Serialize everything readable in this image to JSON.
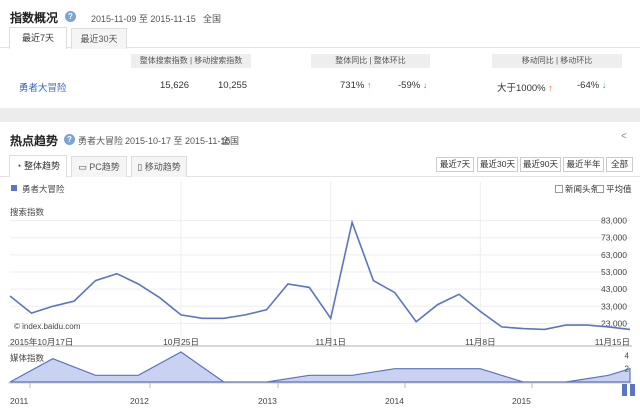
{
  "overview": {
    "title": "指数概况",
    "date_range": "2015-11-09 至 2015-11-15",
    "region": "全国",
    "tabs": [
      {
        "label": "最近7天",
        "active": true
      },
      {
        "label": "最近30天",
        "active": false
      }
    ],
    "headers": {
      "index_pc_mobile": "整体搜索指数 | 移动搜索指数",
      "overall_compare": "整体同比 | 整体环比",
      "mobile_compare": "移动同比 | 移动环比"
    },
    "row": {
      "keyword": "勇者大冒险",
      "overall_index": "15,626",
      "mobile_index": "10,255",
      "overall_yoy": "731%",
      "overall_yoy_dir": "up",
      "overall_mom": "-59%",
      "overall_mom_dir": "down",
      "mobile_yoy": "大于1000%",
      "mobile_yoy_dir": "up",
      "mobile_mom": "-64%",
      "mobile_mom_dir": "down"
    }
  },
  "trend": {
    "title": "热点趋势",
    "keyword": "勇者大冒险",
    "date_range": "2015-10-17 至 2015-11-15",
    "region": "全国",
    "tabs": [
      {
        "label": "整体趋势",
        "icon": "pie-icon",
        "active": true
      },
      {
        "label": "PC趋势",
        "icon": "monitor-icon",
        "active": false
      },
      {
        "label": "移动趋势",
        "icon": "phone-icon",
        "active": false
      }
    ],
    "range_buttons": [
      "最近7天",
      "最近30天",
      "最近90天",
      "最近半年",
      "全部"
    ],
    "legend_label": "勇者大冒险",
    "checkboxes": [
      "新闻头条",
      "平均值"
    ],
    "y_axis_label": "搜索指数",
    "media_axis_label": "媒体指数",
    "watermark": "© index.baidu.com",
    "colors": {
      "series": "#5b74c4",
      "area": "#c9d2f0",
      "accent": "#3a67c4"
    }
  },
  "chart_data": [
    {
      "type": "line",
      "title": "",
      "ylabel": "搜索指数",
      "x_tick_labels": [
        "2015年10月17日",
        "10月25日",
        "11月1日",
        "11月8日",
        "11月15日"
      ],
      "y_tick_labels": [
        "83,000",
        "73,000",
        "63,000",
        "53,000",
        "43,000",
        "33,000",
        "23,000"
      ],
      "ylim": [
        18000,
        88000
      ],
      "grid": true,
      "series": [
        {
          "name": "勇者大冒险",
          "x": [
            "2015-10-17",
            "2015-10-18",
            "2015-10-19",
            "2015-10-20",
            "2015-10-21",
            "2015-10-22",
            "2015-10-23",
            "2015-10-24",
            "2015-10-25",
            "2015-10-26",
            "2015-10-27",
            "2015-10-28",
            "2015-10-29",
            "2015-10-30",
            "2015-10-31",
            "2015-11-01",
            "2015-11-02",
            "2015-11-03",
            "2015-11-04",
            "2015-11-05",
            "2015-11-06",
            "2015-11-07",
            "2015-11-08",
            "2015-11-09",
            "2015-11-10",
            "2015-11-11",
            "2015-11-12",
            "2015-11-13",
            "2015-11-14",
            "2015-11-15"
          ],
          "values": [
            39000,
            29000,
            33000,
            36000,
            48000,
            52000,
            46000,
            38000,
            28000,
            26000,
            26000,
            28000,
            31000,
            46000,
            44000,
            26000,
            82000,
            48000,
            41000,
            24000,
            34000,
            40000,
            30000,
            21000,
            20000,
            19500,
            22000,
            22000,
            21000,
            19500
          ]
        }
      ]
    },
    {
      "type": "area",
      "title": "",
      "ylabel": "媒体指数",
      "x_tick_labels": [
        "2011",
        "2012",
        "2013",
        "2014",
        "2015"
      ],
      "y_tick_labels": [
        "4",
        "2"
      ],
      "ylim": [
        0,
        4.5
      ],
      "series": [
        {
          "name": "媒体指数",
          "x": [
            "2015-10-17",
            "2015-10-19",
            "2015-10-21",
            "2015-10-23",
            "2015-10-25",
            "2015-10-27",
            "2015-10-29",
            "2015-10-31",
            "2015-11-02",
            "2015-11-04",
            "2015-11-06",
            "2015-11-08",
            "2015-11-10",
            "2015-11-12",
            "2015-11-14",
            "2015-11-15"
          ],
          "values": [
            0,
            3.5,
            1,
            1,
            4.5,
            0,
            0,
            1,
            1,
            2,
            2,
            2,
            0,
            0,
            1,
            2
          ]
        }
      ]
    }
  ]
}
